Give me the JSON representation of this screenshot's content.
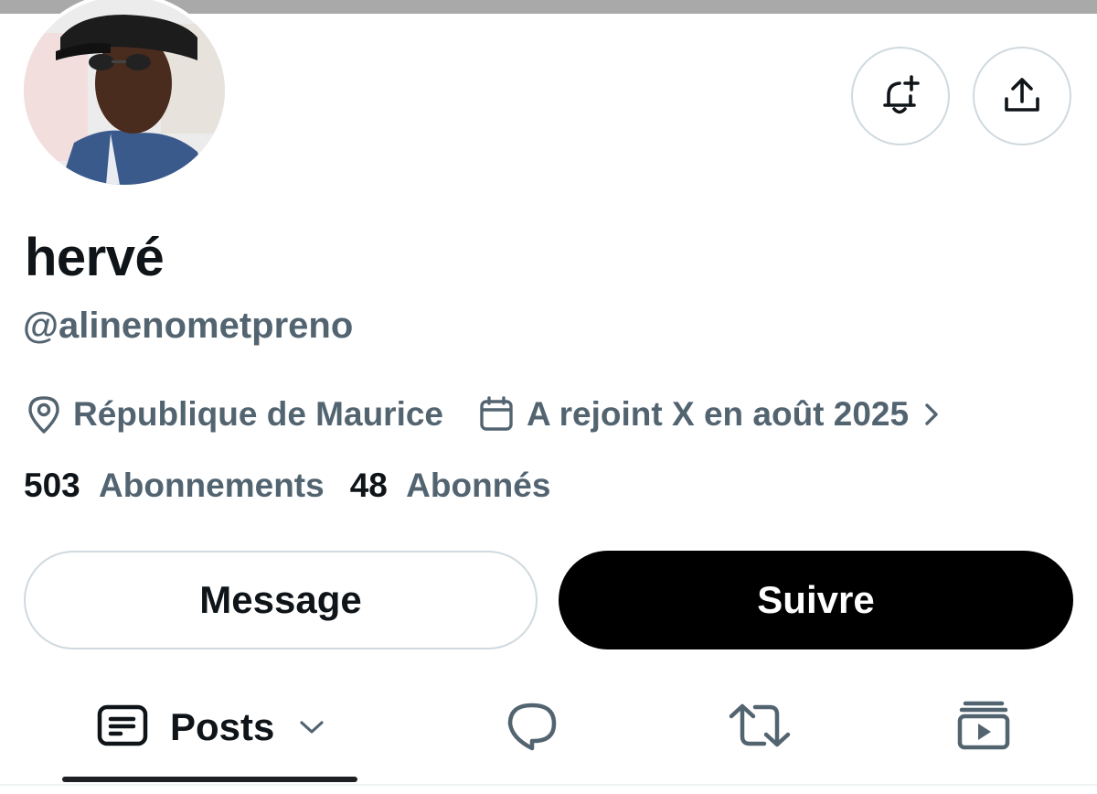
{
  "profile": {
    "display_name": "hervé",
    "handle": "@alinenometpreno",
    "location": "République de Maurice",
    "joined": "A rejoint X en août 2025",
    "following_count": "503",
    "following_label": "Abonnements",
    "followers_count": "48",
    "followers_label": "Abonnés"
  },
  "actions": {
    "message_label": "Message",
    "follow_label": "Suivre"
  },
  "header_buttons": {
    "notify_icon": "bell-plus-icon",
    "share_icon": "share-upload-icon"
  },
  "tabs": [
    {
      "label": "Posts",
      "icon": "posts-icon",
      "selected": true,
      "has_dropdown": true
    },
    {
      "label": "",
      "icon": "reply-bubble-icon",
      "selected": false
    },
    {
      "label": "",
      "icon": "repost-icon",
      "selected": false
    },
    {
      "label": "",
      "icon": "video-stack-icon",
      "selected": false
    }
  ],
  "colors": {
    "primary_text": "#0f1419",
    "secondary_text": "#536471",
    "border": "#cfd9de",
    "follow_button_bg": "#000000",
    "banner_gray": "#a9a9a9"
  }
}
